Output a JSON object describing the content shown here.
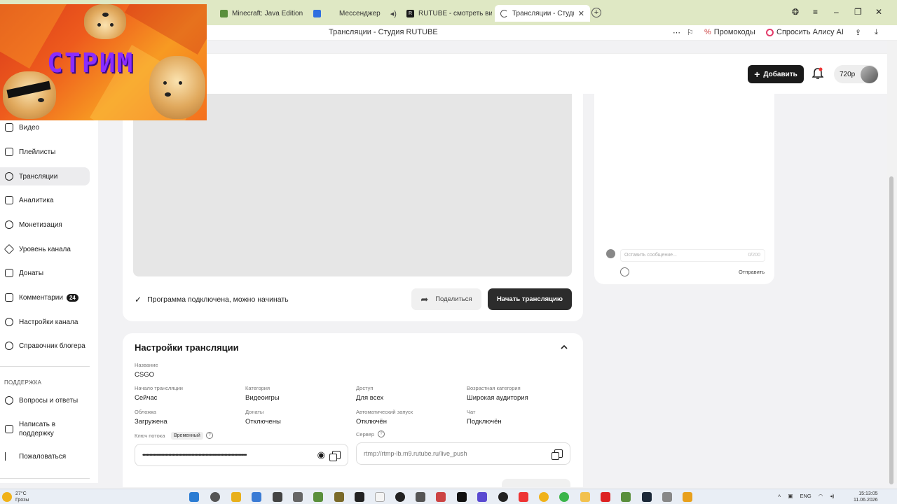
{
  "browser": {
    "tabs": [
      {
        "label": "Minecraft: Java Edition — ",
        "color": "#5a8f3c"
      },
      {
        "label": "Мессенджер",
        "color": "#2f6fe0"
      },
      {
        "label": "RUTUBE - смотреть виде",
        "color": "#1a1a1a"
      },
      {
        "label": "Трансляции - Студия R",
        "color": "#ffffff"
      }
    ],
    "address_title": "Трансляции - Студия RUTUBE",
    "promo": "Промокоды",
    "alice": "Спросить Алису AI"
  },
  "header": {
    "add_label": "Добавить",
    "quality": "720p"
  },
  "overlay": {
    "word": "СТРИМ"
  },
  "sidebar": {
    "items": [
      {
        "label": "Видео"
      },
      {
        "label": "Плейлисты"
      },
      {
        "label": "Трансляции"
      },
      {
        "label": "Аналитика"
      },
      {
        "label": "Монетизация"
      },
      {
        "label": "Уровень канала"
      },
      {
        "label": "Донаты"
      },
      {
        "label": "Комментарии",
        "badge": "24"
      },
      {
        "label": "Настройки канала"
      },
      {
        "label": "Справочник блогера"
      }
    ],
    "support_heading": "ПОДДЕРЖКА",
    "support_items": [
      {
        "label": "Вопросы и ответы"
      },
      {
        "label": "Написать в поддержку"
      },
      {
        "label": "Пожаловаться"
      }
    ]
  },
  "player": {
    "status": "Программа подключена, можно начинать",
    "share_label": "Поделиться",
    "start_label": "Начать трансляцию"
  },
  "chat": {
    "placeholder": "Оставить сообщение...",
    "counter": "0/200",
    "send_label": "Отправить"
  },
  "settings": {
    "title": "Настройки трансляции",
    "name_label": "Название",
    "name_value": "CSGO",
    "fields": [
      {
        "label": "Начало трансляции",
        "value": "Сейчас"
      },
      {
        "label": "Категория",
        "value": "Видеоигры"
      },
      {
        "label": "Доступ",
        "value": "Для всех"
      },
      {
        "label": "Возрастная категория",
        "value": "Широкая аудитория"
      },
      {
        "label": "Обложка",
        "value": "Загружена"
      },
      {
        "label": "Донаты",
        "value": "Отключены"
      },
      {
        "label": "Автоматический запуск",
        "value": "Отключён"
      },
      {
        "label": "Чат",
        "value": "Подключён"
      }
    ],
    "key_label": "Ключ потока",
    "key_badge": "Временный",
    "key_mask": "••••••••••••••••••••••••••••••••••••••••••••••••••••••••••••••••••••••••••••",
    "server_label": "Сервер",
    "server_value": "rtmp://rtmp-lb.m9.rutube.ru/live_push"
  },
  "taskbar": {
    "temperature": "27°C",
    "weather": "Грозы",
    "lang": "ENG",
    "time": "15:13:05",
    "date": "11.06.2026"
  },
  "colors": {
    "accent": "#1a1a1a",
    "tabbar": "#dfe8c4",
    "stream_word": "#8a2cff"
  }
}
